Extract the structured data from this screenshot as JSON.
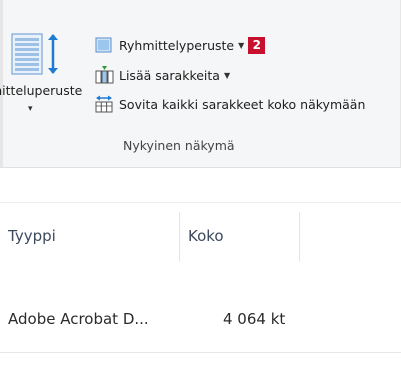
{
  "ribbon": {
    "group_by_large": {
      "label": "mitteluperuste",
      "icon": "group-by-columns-icon"
    },
    "commands": [
      {
        "label": "Ryhmittelyperuste",
        "icon": "group-by-icon",
        "has_dropdown": true,
        "badge": "2"
      },
      {
        "label": "Lisää sarakkeita",
        "icon": "add-columns-icon",
        "has_dropdown": true
      },
      {
        "label": "Sovita kaikki sarakkeet koko näkymään",
        "icon": "size-columns-to-fit-icon",
        "has_dropdown": false
      }
    ],
    "group_label": "Nykyinen näkymä"
  },
  "columns": {
    "type": "Tyyppi",
    "size": "Koko"
  },
  "rows": [
    {
      "type": "Adobe Acrobat D...",
      "size": "4 064 kt"
    }
  ],
  "colors": {
    "ribbon_bg": "#f5f6f7",
    "badge": "#c8102e",
    "header_text": "#3c4a5e",
    "icon_blue": "#1e7bd1"
  }
}
